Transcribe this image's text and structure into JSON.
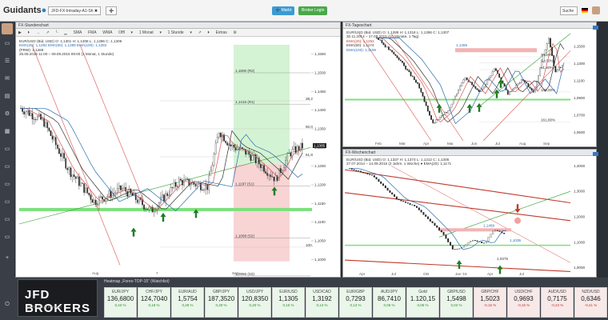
{
  "app": {
    "logo_text": "Guidants",
    "tab1": "JFD-FX-Intraday-A1-Sh ✖",
    "tab2": "➕",
    "btn_market": "➕ Markt",
    "btn_broker": "Broker Login",
    "search": "Suche",
    "colors": {
      "accent": "#3a9bd5",
      "broker_btn": "#4aa84a"
    }
  },
  "left_toolbar": {
    "icons": [
      "user-icon",
      "desktop-icon",
      "list-icon",
      "chat-icon",
      "folder-icon",
      "gear-icon",
      "grid-icon",
      "monitor-icon",
      "monitor-icon",
      "monitor-icon",
      "monitor-icon",
      "monitor-icon",
      "chart-icon",
      "plus-icon",
      "power-icon"
    ]
  },
  "hourly": {
    "title": "FX-Stundenchart",
    "toolbar": [
      "▶",
      "⏵",
      "→",
      "↗",
      "╰",
      "▁",
      "SMA",
      "FMA",
      "WMA",
      "Offl",
      "▾",
      "1 Monat",
      "▾",
      "1 Stunde",
      "▾",
      "↗",
      "⏵",
      "Extras",
      "⚙"
    ],
    "legend": [
      "EUR/USD (Bid, USD) O: 1,1301 H: 1,1308 L: 1,1286 C: 1,1305",
      "EMA(20): 1,1282   EMA(50): 1,1289   EMA(100): 1,1282",
      "(PRW): 1,1269",
      "25.08.2015 11:00 – 09.09.2015 09:00 (1 Monat, 1 Stunde)"
    ],
    "levels": [
      {
        "label": "1,1500 (R2)",
        "price": 1.15
      },
      {
        "label": "1,1416 (R1)",
        "price": 1.1416
      },
      {
        "label": "1,1197 (S1)",
        "price": 1.1197
      },
      {
        "label": "1,1058 (S2)",
        "price": 1.1058
      },
      {
        "label": "1,0956 (S3)",
        "price": 1.0956
      }
    ],
    "fib": [
      {
        "label": "38,20%",
        "price": 1.1425
      },
      {
        "label": "50,00%",
        "price": 1.135
      },
      {
        "label": "61,80%",
        "price": 1.1275
      },
      {
        "label": "100,00%",
        "price": 1.1033
      }
    ],
    "y_ticks": [
      "1,1550",
      "1,1500",
      "1,1450",
      "1,1400",
      "1,1350",
      "1,1300",
      "1,1250",
      "1,1200",
      "1,1150",
      "1,1100",
      "1,1050",
      "1,1000"
    ],
    "last": "1,1305",
    "x_ticks": [
      "Aug",
      "7",
      "Sep"
    ]
  },
  "daily": {
    "title": "FX-Tageschart",
    "legend": [
      "EUR/USD (Bid, USD) O: 1,1289 H: 1,1318 L: 1,1286 C: 1,1307",
      "30.11.2014 – 17.09.2015 (10 Monate, 1 Tag)",
      "EMA(20): 1,1252",
      "EMA(50): 1,1174",
      "EMA(100): 1,1159"
    ],
    "notes": [
      "1,1455",
      "38,20%",
      "50,00%",
      "61,80%",
      "100,00%",
      "161,80%"
    ],
    "x_ticks": [
      "Feb",
      "Mär",
      "Apr",
      "Mai",
      "Jun",
      "Jul",
      "Aug",
      "Sep"
    ],
    "y_ticks": [
      "1,1500",
      "1,1300",
      "1,1100",
      "1,0900",
      "1,0700",
      "1,0500"
    ]
  },
  "weekly": {
    "title": "FX-Wochenchart",
    "legend": [
      "EUR/USD (Bid, USD) O: 1,1337 H: 1,1373 L: 1,1212 C: 1,1306",
      "27.07.2014 – 14.09.2015 (2 Jahre, 1 Woche)  ● EMA(20): 1,1171"
    ],
    "notes": [
      "1,1469",
      "1,1035",
      "1,0375"
    ],
    "x_ticks": [
      "Apr",
      "Jul",
      "Okt",
      "Jan '15",
      "Apr",
      "Jul"
    ],
    "y_ticks": [
      "1,4000",
      "1,3000",
      "1,2000",
      "1,1000",
      "1,0000"
    ]
  },
  "watchlist": {
    "title": "Heatmap „Forex-TOP-15“ (Watchlist)",
    "broker": "JFD BROKERS",
    "broker_sub": "TRUST YOUR BROKER",
    "items": [
      {
        "name": "EUR/JPY",
        "price": "136,6800",
        "change": "0,43 %",
        "up": true
      },
      {
        "name": "CHF/JPY",
        "price": "124,7040",
        "change": "0,18 %",
        "up": true
      },
      {
        "name": "EUR/AUD",
        "price": "1,5754",
        "change": "0,28 %",
        "up": true
      },
      {
        "name": "GBP/JPY",
        "price": "187,3520",
        "change": "0,29 %",
        "up": true
      },
      {
        "name": "USD/JPY",
        "price": "120,8350",
        "change": "0,20 %",
        "up": true
      },
      {
        "name": "EUR/USD",
        "price": "1,1305",
        "change": "0,15 %",
        "up": true
      },
      {
        "name": "USD/CAD",
        "price": "1,3192",
        "change": "0,13 %",
        "up": true
      },
      {
        "name": "EUR/GBP",
        "price": "0,7293",
        "change": "0,13 %",
        "up": true
      },
      {
        "name": "AUD/JPY",
        "price": "86,7410",
        "change": "0,06 %",
        "up": true
      },
      {
        "name": "Gold",
        "price": "1.120,15",
        "change": "0,05 %",
        "up": true
      },
      {
        "name": "GBP/USD",
        "price": "1,5498",
        "change": "0,02 %",
        "up": true
      },
      {
        "name": "GBP/CHF",
        "price": "1,5023",
        "change": "-0,15 %",
        "up": false
      },
      {
        "name": "USD/CHF",
        "price": "0,9693",
        "change": "-0,15 %",
        "up": false
      },
      {
        "name": "AUD/USD",
        "price": "0,7175",
        "change": "-0,23 %",
        "up": false
      },
      {
        "name": "NZD/USD",
        "price": "0,6346",
        "change": "-0,41 %",
        "up": false
      }
    ]
  }
}
